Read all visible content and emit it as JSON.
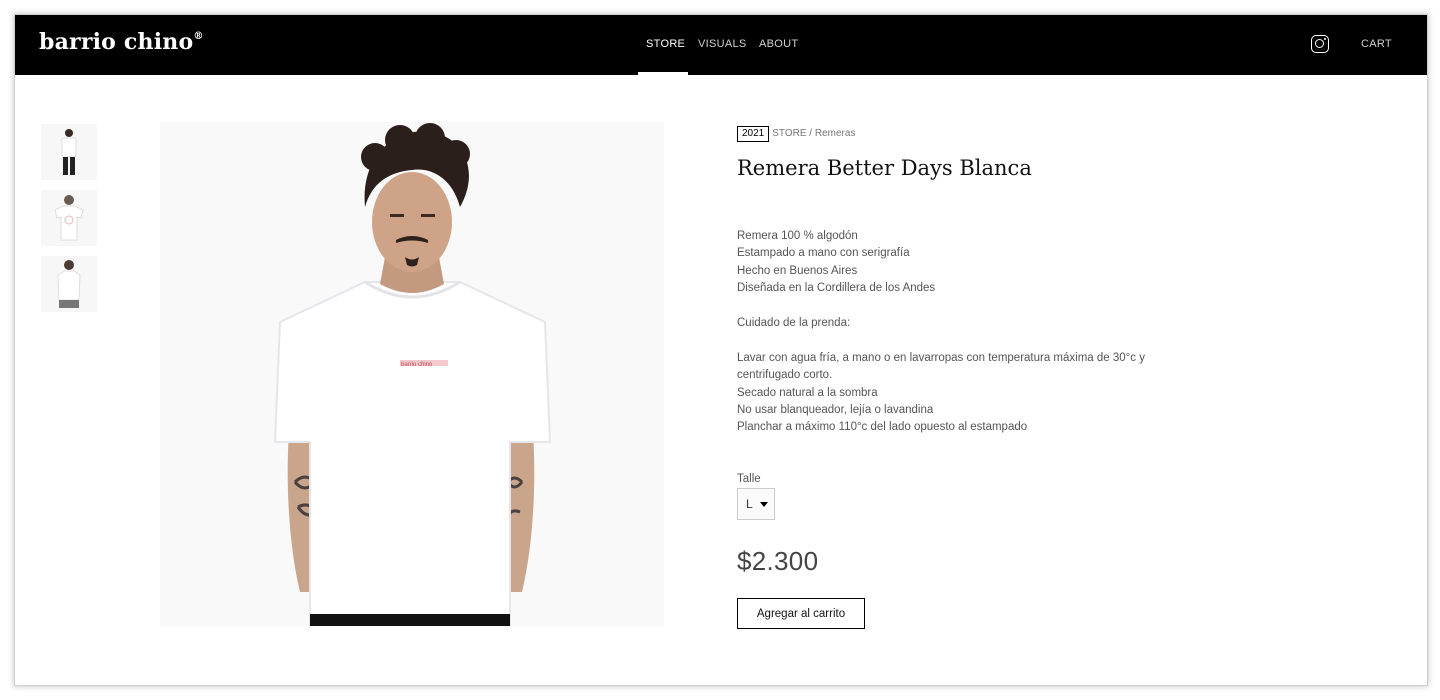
{
  "header": {
    "logo": "barrio chino",
    "logo_mark": "®",
    "nav": [
      {
        "label": "STORE",
        "active": true
      },
      {
        "label": "VISUALS",
        "active": false
      },
      {
        "label": "ABOUT",
        "active": false
      }
    ],
    "instagram_icon": "instagram-icon",
    "cart_label": "CART"
  },
  "gallery": {
    "thumbnails": [
      "front",
      "back",
      "side"
    ],
    "main_image": "model-front"
  },
  "product": {
    "year": "2021",
    "breadcrumb_store": "STORE",
    "breadcrumb_sep": " / ",
    "breadcrumb_category": "Remeras",
    "title": "Remera Better Days Blanca",
    "description_1": [
      "Remera 100 % algodón",
      "Estampado a mano con serigrafía",
      "Hecho en Buenos Aires",
      "Diseñada en la Cordillera de los Andes"
    ],
    "care_heading": "Cuidado de la prenda:",
    "description_2": [
      "Lavar con agua fría, a mano o en lavarropas con temperatura máxima de 30°c y centrifugado corto.",
      "Secado natural a la sombra",
      "No usar blanqueador, lejía o lavandina",
      "Planchar a máximo 110°c del lado opuesto al estampado"
    ],
    "size_label": "Talle",
    "size_value": "L",
    "price": "$2.300",
    "add_to_cart_label": "Agregar al carrito"
  },
  "colors": {
    "header_bg": "#000000",
    "text": "#555555"
  }
}
